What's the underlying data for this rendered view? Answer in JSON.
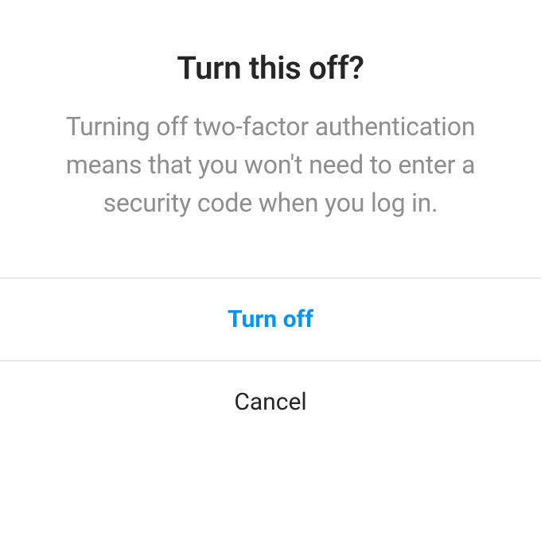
{
  "dialog": {
    "title": "Turn this off?",
    "message": "Turning off two-factor authentica­tion means that you won't need to enter a security code when you log in.",
    "actions": {
      "confirm": "Turn off",
      "cancel": "Cancel"
    }
  }
}
